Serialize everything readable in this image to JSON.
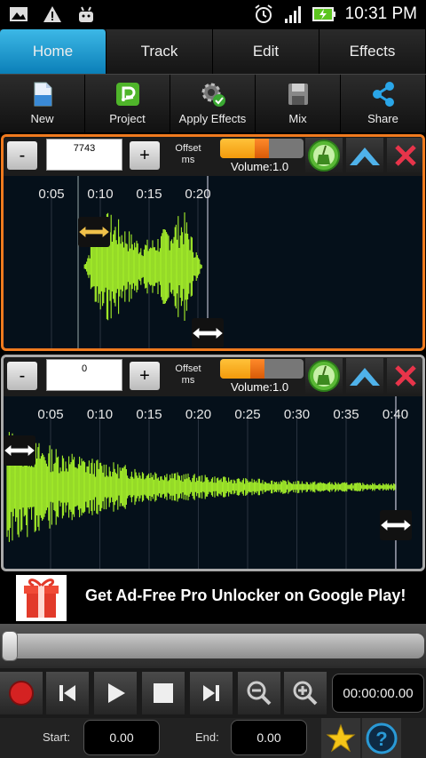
{
  "status_bar": {
    "time": "10:31 PM"
  },
  "tabs": [
    {
      "label": "Home",
      "active": true
    },
    {
      "label": "Track",
      "active": false
    },
    {
      "label": "Edit",
      "active": false
    },
    {
      "label": "Effects",
      "active": false
    }
  ],
  "toolbar": [
    {
      "label": "New",
      "icon": "new-file-icon"
    },
    {
      "label": "Project",
      "icon": "project-icon"
    },
    {
      "label": "Apply Effects",
      "icon": "apply-effects-icon"
    },
    {
      "label": "Mix",
      "icon": "mix-icon"
    },
    {
      "label": "Share",
      "icon": "share-icon"
    }
  ],
  "tracks": [
    {
      "offset_value": "7743",
      "minus": "-",
      "plus": "+",
      "offset_label": "Offset ms",
      "volume_label": "Volume:1.0",
      "volume_fraction": 0.5,
      "time_ticks": [
        "0:05",
        "0:10",
        "0:15",
        "0:20"
      ],
      "selected": true
    },
    {
      "offset_value": "0",
      "minus": "-",
      "plus": "+",
      "offset_label": "Offset ms",
      "volume_label": "Volume:1.0",
      "volume_fraction": 0.45,
      "time_ticks": [
        "0:05",
        "0:10",
        "0:15",
        "0:20",
        "0:25",
        "0:30",
        "0:35",
        "0:40"
      ],
      "selected": false
    }
  ],
  "ad": {
    "text": "Get Ad-Free Pro Unlocker on Google Play!"
  },
  "seek": {
    "position_fraction": 0.0
  },
  "transport": {
    "time": "00:00:00.00"
  },
  "bottom": {
    "start_label": "Start:",
    "start_value": "0.00",
    "end_label": "End:",
    "end_value": "0.00"
  },
  "colors": {
    "accent": "#0b7fb8",
    "waveform": "#a6f22a",
    "selected_border": "#f07a1e"
  }
}
